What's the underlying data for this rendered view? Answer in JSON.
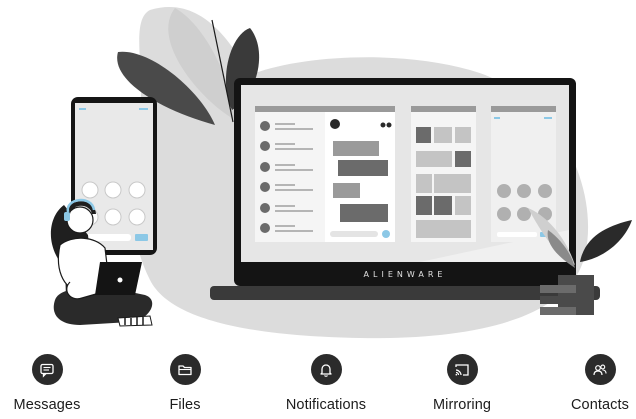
{
  "hero": {
    "laptop_brand": "ALIENWARE"
  },
  "features": [
    {
      "label": "Messages",
      "icon": "message-icon"
    },
    {
      "label": "Files",
      "icon": "folder-icon"
    },
    {
      "label": "Notifications",
      "icon": "bell-icon"
    },
    {
      "label": "Mirroring",
      "icon": "cast-icon"
    },
    {
      "label": "Contacts",
      "icon": "contacts-icon"
    }
  ],
  "colors": {
    "icon_circle": "#2b2b2b",
    "background_blob": "#d9d9d9",
    "accent_blue": "#8cc8e6"
  }
}
